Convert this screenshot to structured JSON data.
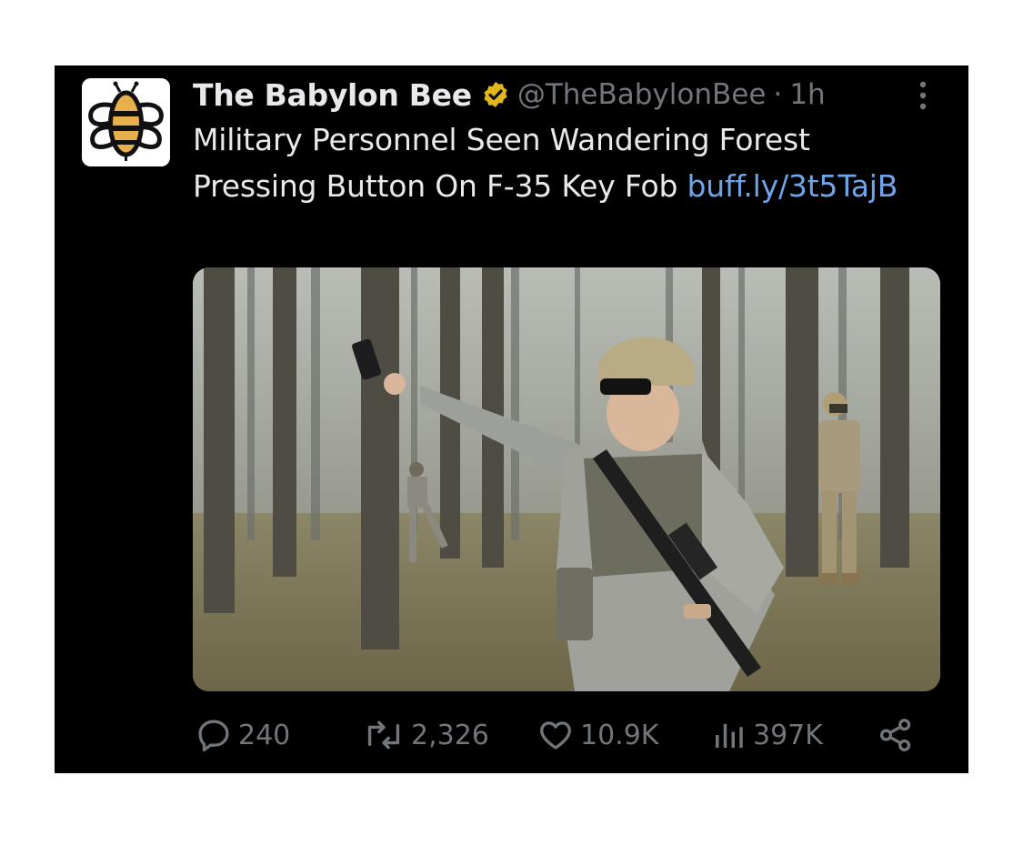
{
  "tweet": {
    "display_name": "The Babylon Bee",
    "handle": "@TheBabylonBee",
    "separator": "·",
    "time": "1h",
    "text": "Military Personnel Seen Wandering Forest Pressing Button On F-35 Key Fob ",
    "link": "buff.ly/3t5TajB",
    "avatar_icon": "babylon-bee-logo",
    "verified_icon": "verified-badge-icon",
    "verified_color": "#e2b719",
    "link_color": "#6fa4e8"
  },
  "media": {
    "description": "soldier-in-forest-photo"
  },
  "actions": {
    "replies": "240",
    "reposts": "2,326",
    "likes": "10.9K",
    "views": "397K"
  },
  "colors": {
    "background": "#000000",
    "text": "#e7e9ea",
    "muted": "#71767b"
  }
}
